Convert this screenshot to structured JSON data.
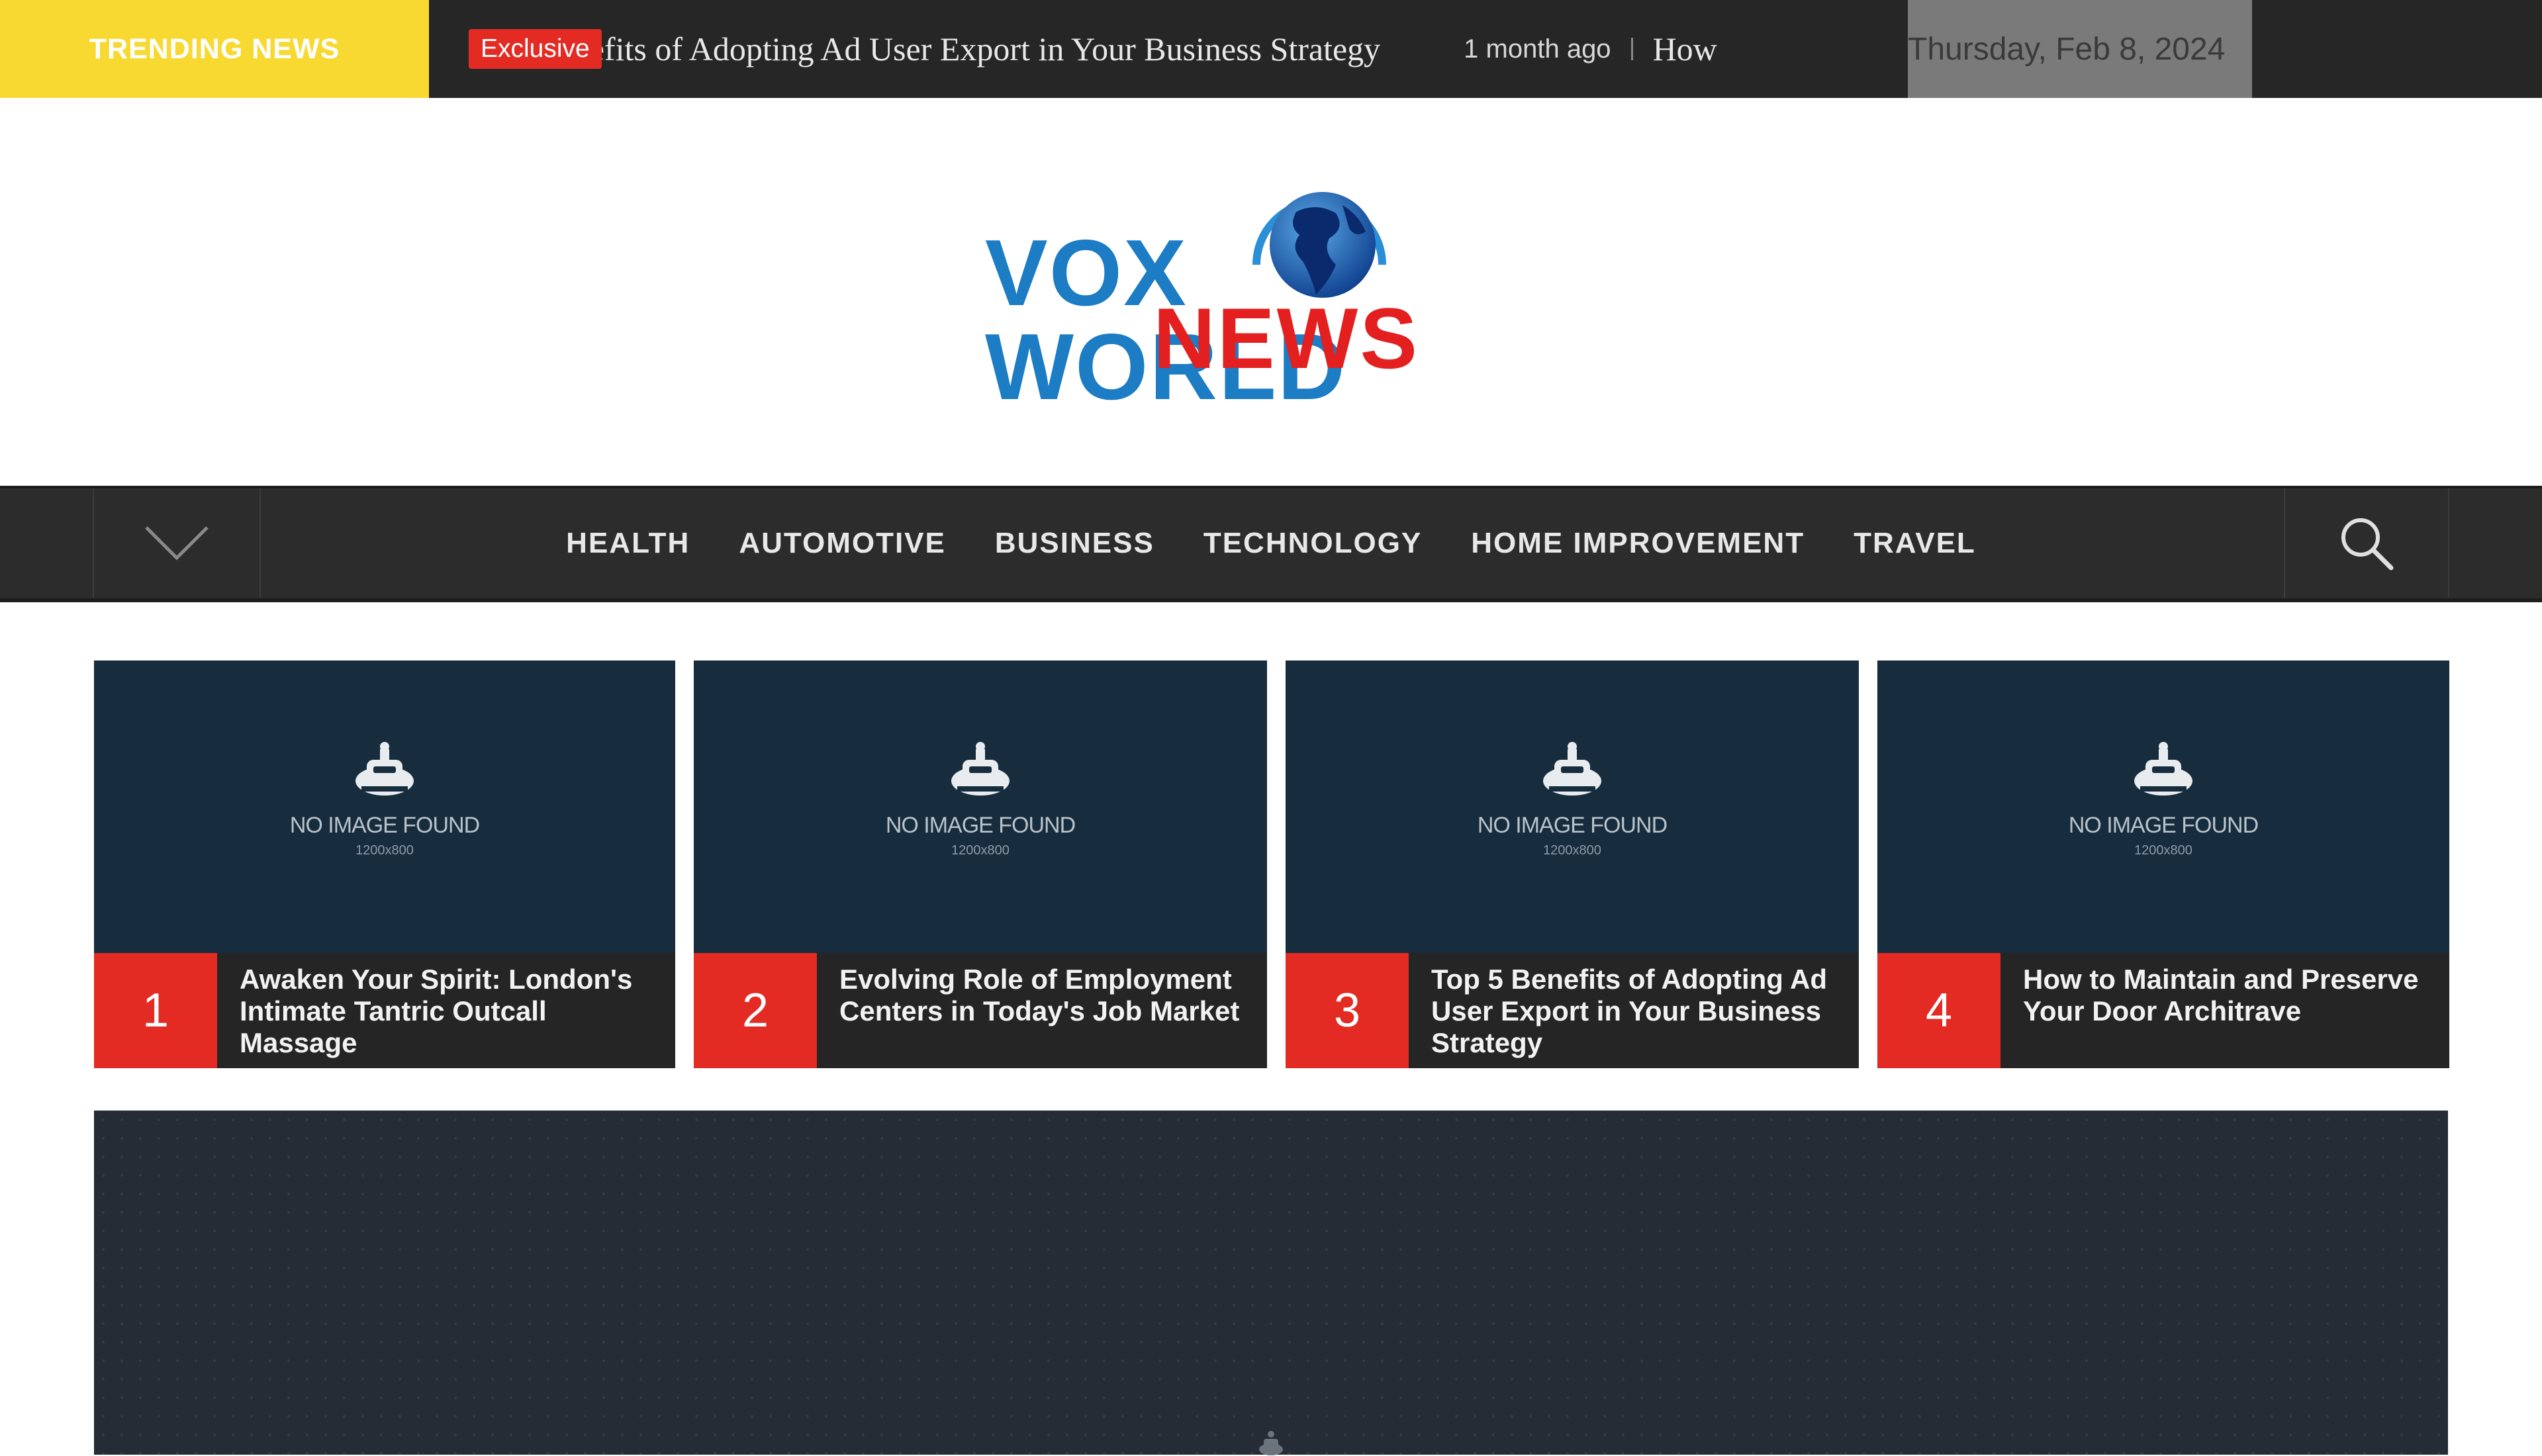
{
  "topbar": {
    "trending_label": "TRENDING NEWS",
    "badge": "Exclusive",
    "ticker_title": "efits of Adopting Ad User Export in Your Business Strategy",
    "ticker_time": "1 month ago",
    "ticker_next": "How",
    "date": "Thursday, Feb 8, 2024"
  },
  "logo": {
    "line1": "VOX WORLD",
    "line2": "NEWS"
  },
  "nav": {
    "items": [
      "HEALTH",
      "AUTOMOTIVE",
      "BUSINESS",
      "TECHNOLOGY",
      "HOME IMPROVEMENT",
      "TRAVEL"
    ],
    "toggle_icon": "chevron-down-icon",
    "search_icon": "search-icon"
  },
  "placeholder": {
    "text": "NO IMAGE FOUND",
    "size": "1200x800"
  },
  "cards": [
    {
      "num": "1",
      "title": "Awaken Your Spirit: London's Intimate Tantric Outcall Massage"
    },
    {
      "num": "2",
      "title": "Evolving Role of Employment Centers in Today's Job Market"
    },
    {
      "num": "3",
      "title": "Top 5 Benefits of Adopting Ad User Export in Your Business Strategy"
    },
    {
      "num": "4",
      "title": "How to Maintain and Preserve Your Door Architrave"
    }
  ],
  "colors": {
    "accent_red": "#e32b23",
    "trending_yellow": "#f8d932",
    "dark_bar": "#262626",
    "card_navy": "#172c3d",
    "logo_blue": "#1c7cc4"
  }
}
